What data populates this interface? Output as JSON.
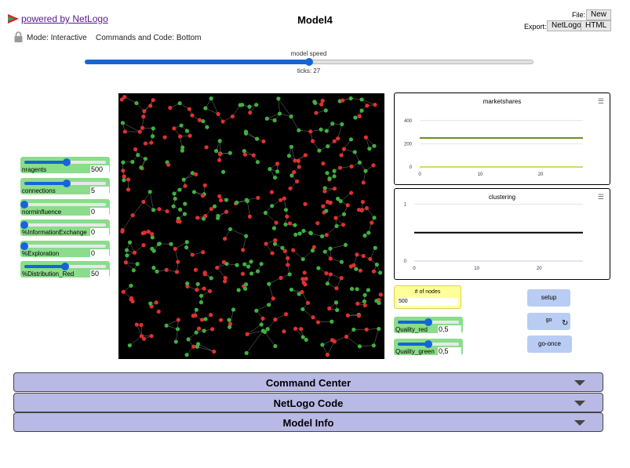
{
  "header": {
    "powered_by": "powered by NetLogo",
    "title": "Model4",
    "file_label": "File:",
    "new_button": "New",
    "export_label": "Export:",
    "export_netlogo": "NetLogo",
    "export_html": "HTML",
    "mode": "Mode: Interactive",
    "code_position": "Commands and Code: Bottom"
  },
  "speed": {
    "label": "model speed",
    "value": 0.5,
    "ticks": "ticks: 27"
  },
  "sliders": [
    {
      "name": "nragents",
      "value": "500",
      "fraction": 0.52
    },
    {
      "name": "connections",
      "value": "5",
      "fraction": 0.52
    },
    {
      "name": "norminfluence",
      "value": "0",
      "fraction": 0.0
    },
    {
      "name": "%InformationExchange",
      "value": "0",
      "fraction": 0.0
    },
    {
      "name": "%Exploration",
      "value": "0",
      "fraction": 0.0
    },
    {
      "name": "%Distribution_Red",
      "value": "50",
      "fraction": 0.5
    },
    {
      "name": "Quality_red",
      "value": "0,5",
      "fraction": 0.5
    },
    {
      "name": "Quality_green",
      "value": "0,5",
      "fraction": 0.5
    }
  ],
  "plots": {
    "marketshares": {
      "title": "marketshares",
      "menu_icon": "hamburger-icon",
      "y_ticks": [
        "400",
        "200",
        "0"
      ],
      "x_ticks": [
        "0",
        "10",
        "20"
      ]
    },
    "clustering": {
      "title": "clustering",
      "menu_icon": "hamburger-icon",
      "y_ticks": [
        "1",
        "0"
      ],
      "x_ticks": [
        "0",
        "10",
        "20"
      ]
    }
  },
  "chart_data": [
    {
      "type": "line",
      "title": "marketshares",
      "xlim": [
        0,
        27
      ],
      "ylim": [
        0,
        500
      ],
      "series": [
        {
          "color": "#6b8e23",
          "x": [
            0,
            27
          ],
          "y": [
            250,
            250
          ]
        },
        {
          "color": "#c8e060",
          "x": [
            0,
            27
          ],
          "y": [
            0,
            0
          ]
        }
      ]
    },
    {
      "type": "line",
      "title": "clustering",
      "xlim": [
        0,
        27
      ],
      "ylim": [
        0,
        1.2
      ],
      "series": [
        {
          "color": "#000000",
          "x": [
            0,
            27
          ],
          "y": [
            0.5,
            0.5
          ]
        }
      ]
    }
  ],
  "monitor": {
    "label": "# of nodes",
    "value": "500"
  },
  "buttons": {
    "setup": "setup",
    "go": "go",
    "go_once": "go-once",
    "go_icon": "forever-icon"
  },
  "panels": [
    "Command Center",
    "NetLogo Code",
    "Model Info"
  ],
  "colors": {
    "agent_red": "#e03030",
    "agent_green": "#40b040",
    "slider_bg": "#8bdc8b",
    "button_bg": "#b8ccf4",
    "panel_bg": "#b9b9e6"
  }
}
